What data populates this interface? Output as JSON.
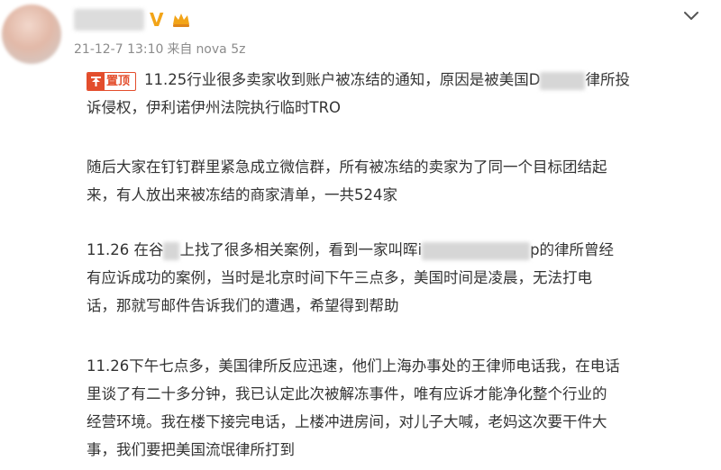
{
  "post": {
    "meta": {
      "date": "21-12-7 13:10",
      "source_prefix": "来自",
      "device": "nova 5z"
    },
    "pin_label": "置顶",
    "paragraphs": [
      {
        "lines": [
          {
            "pre": "11.25行业很多卖家收到账户被冻结的通知，原因是被美国D",
            "post": "律所投"
          },
          {
            "pre": "诉侵权，伊利诺伊州法院执行临时TRO",
            "post": ""
          }
        ]
      },
      {
        "lines": [
          {
            "pre": "随后大家在钉钉群里紧急成立微信群，所有被冻结的卖家为了同一个目标团结起",
            "post": ""
          },
          {
            "pre": "来，有人放出来被冻结的商家清单，一共524家",
            "post": ""
          }
        ]
      },
      {
        "lines": [
          {
            "pre": "11.26 在谷",
            "mid": "上找了很多相关案例，看到一家叫晖i",
            "post": "p的律所曾经"
          },
          {
            "pre": "有应诉成功的案例，当时是北京时间下午三点多，美国时间是凌晨，无法打电",
            "post": ""
          },
          {
            "pre": "话，那就写邮件告诉我们的遭遇，希望得到帮助",
            "post": ""
          }
        ]
      },
      {
        "lines": [
          {
            "pre": "11.26下午七点多，美国律所反应迅速，他们上海办事处的王律师电话我，在电话",
            "post": ""
          },
          {
            "pre": "里谈了有二十多分钟，我已认定此次被解冻事件，唯有应诉才能净化整个行业的",
            "post": ""
          },
          {
            "pre": "经营环境。我在楼下接完电话，上楼冲进房间，对儿子大喊，老妈这次要干件大",
            "post": ""
          },
          {
            "pre": "事，我们要把美国流氓律所打到",
            "post": ""
          }
        ]
      }
    ]
  },
  "icons": {
    "verified": "V",
    "vip": "vip-crown-icon",
    "more": "chevron-down-icon",
    "pin": "pin-icon"
  },
  "colors": {
    "accent": "#e34d2c",
    "verified": "#f2a418",
    "meta": "#8c8c8c",
    "text": "#333333"
  }
}
